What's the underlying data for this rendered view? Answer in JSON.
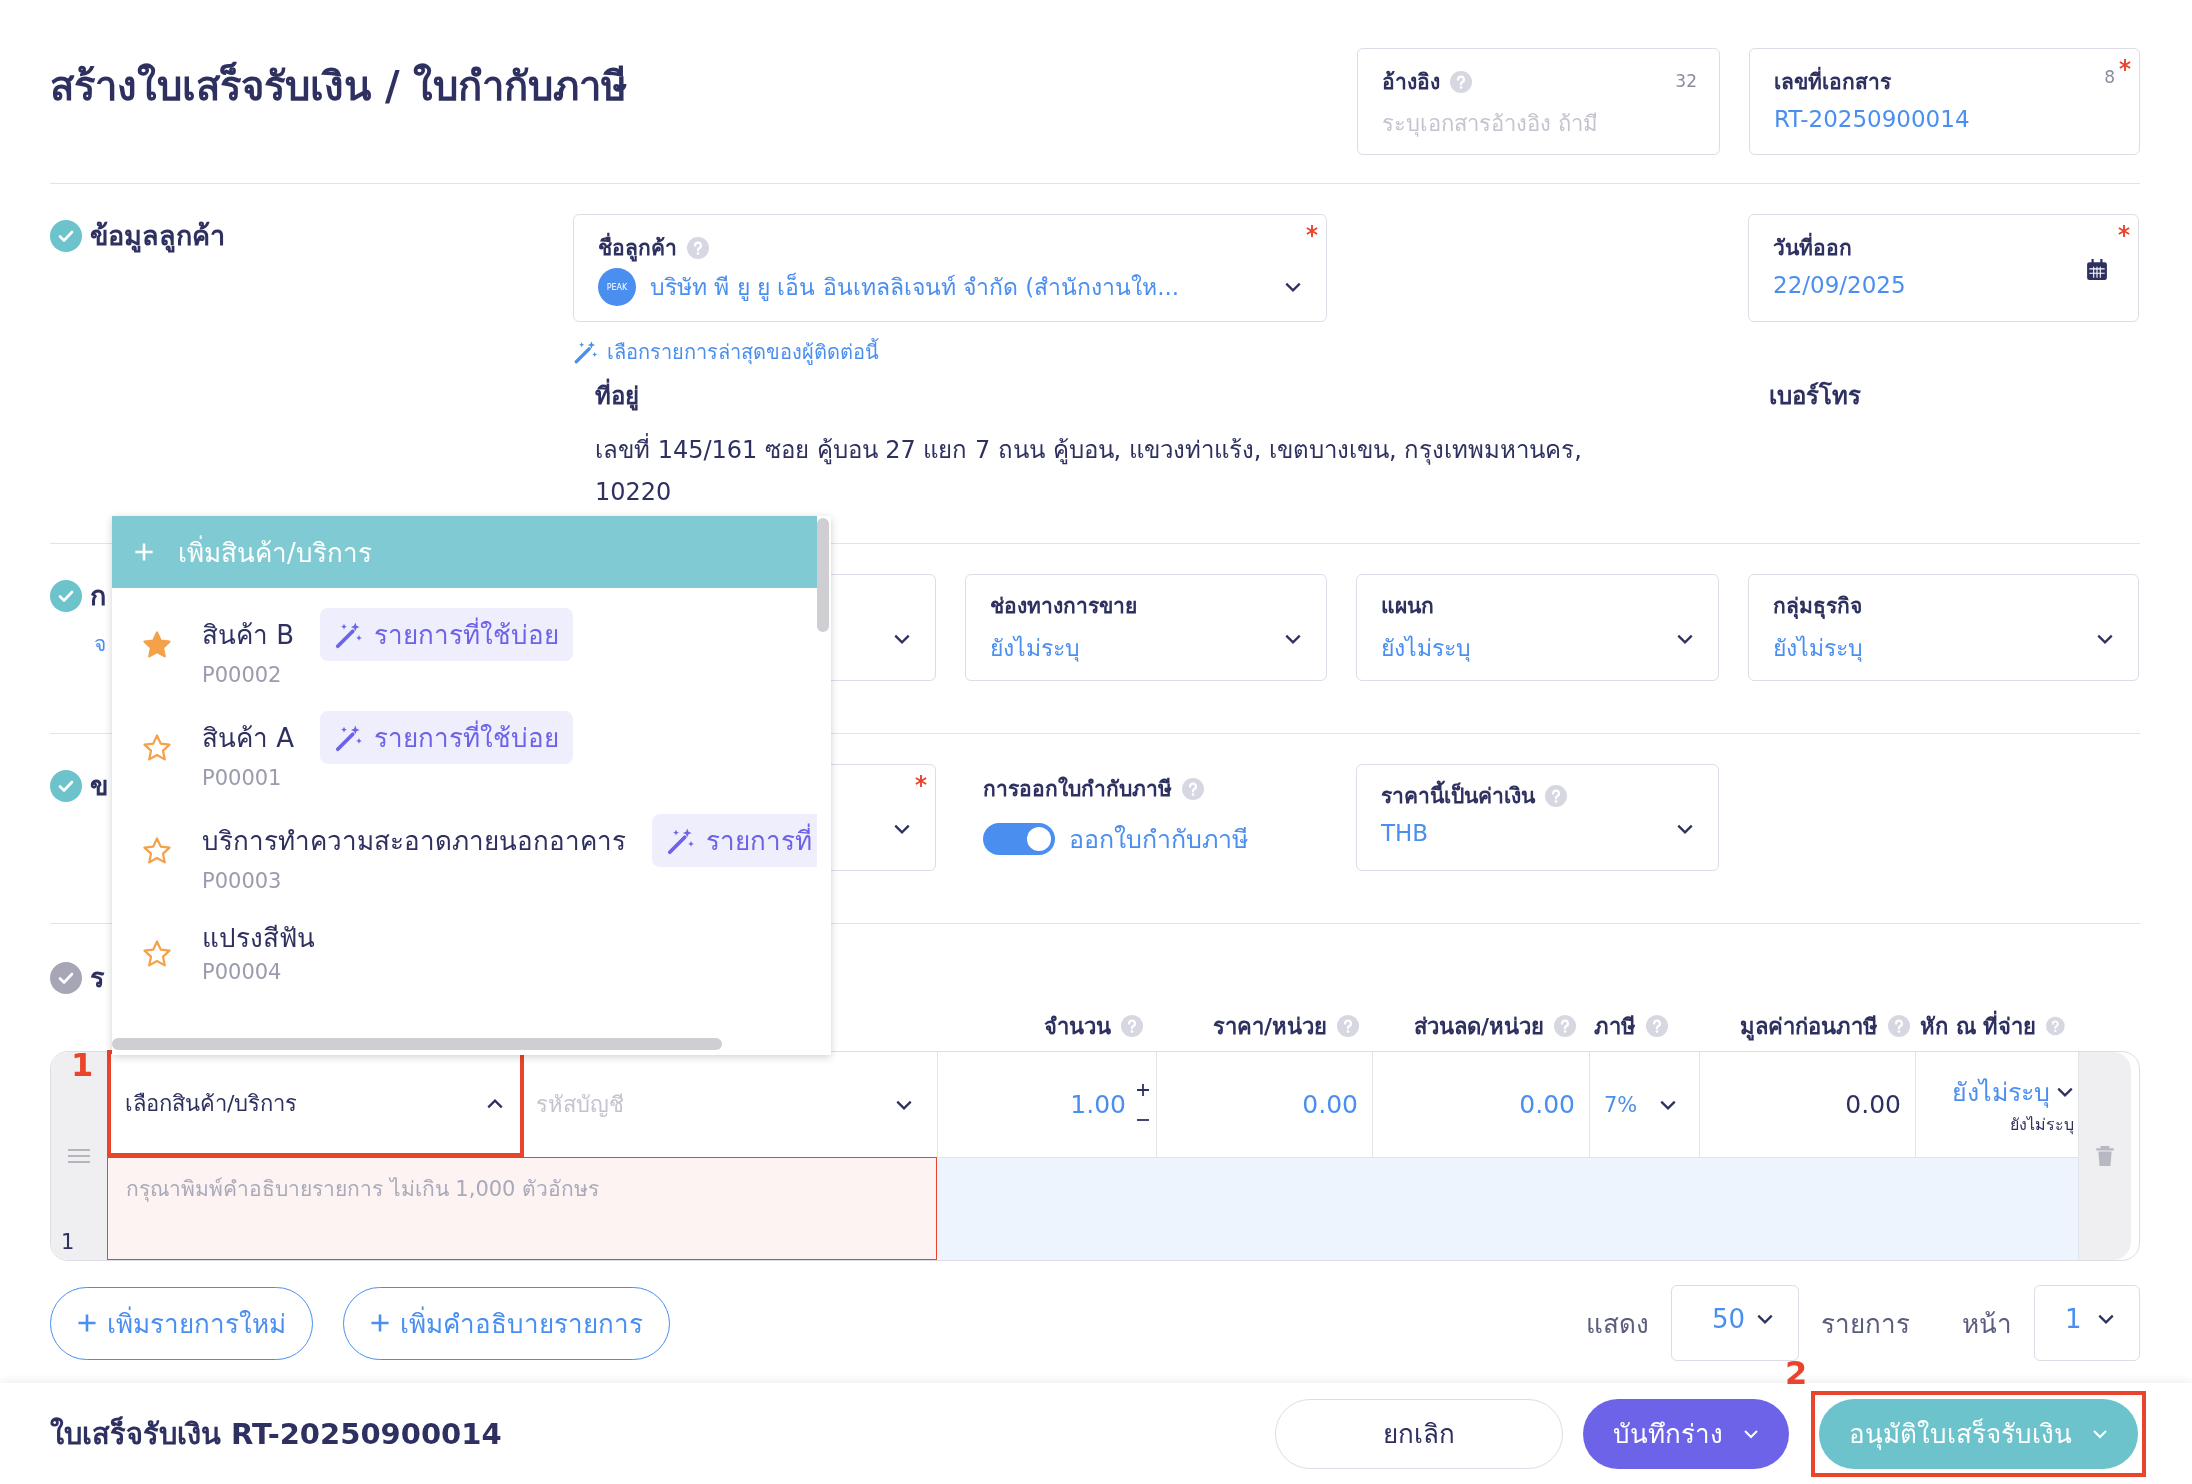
{
  "page_title": "สร้างใบเสร็จรับเงิน / ใบกำกับภาษี",
  "header_fields": [
    {
      "label": "อ้างอิง",
      "help": true,
      "counter": "32",
      "placeholder": "ระบุเอกสารอ้างอิง ถ้ามี",
      "required": false
    },
    {
      "label": "เลขที่เอกสาร",
      "help": false,
      "counter": "8",
      "value": "RT-20250900014",
      "required": true
    }
  ],
  "sections": [
    {
      "kind": "customer",
      "title": "ข้อมูลลูกค้า",
      "done": true,
      "customer": {
        "label": "ชื่อลูกค้า",
        "help": true,
        "required": true,
        "avatar": "PEAK",
        "value": "บริษัท พี ยู ยู เอ็น อินเทลลิเจนท์ จำกัด (สำนักงานให..."
      },
      "issue_date": {
        "label": "วันที่ออก",
        "required": true,
        "value": "22/09/2025"
      },
      "recent_link": "เลือกรายการล่าสุดของผู้ติดต่อนี้",
      "address": {
        "label": "ที่อยู่",
        "value": "เลขที่ 145/161 ซอย คู้บอน 27 แยก 7 ถนน คู้บอน, แขวงท่าแร้ง, เขตบางเขน, กรุงเทพมหานคร, 10220"
      },
      "phone": {
        "label": "เบอร์โทร"
      }
    },
    {
      "kind": "fields",
      "title": "ก",
      "link": "จ",
      "done": true,
      "fields": [
        {
          "kind": "select",
          "required": false
        },
        {
          "kind": "select",
          "label": "ช่องทางการขาย",
          "value": "ยังไม่ระบุ",
          "required": false
        },
        {
          "kind": "select",
          "label": "แผนก",
          "value": "ยังไม่ระบุ",
          "required": false
        },
        {
          "kind": "select",
          "label": "กลุ่มธุรกิจ",
          "value": "ยังไม่ระบุ",
          "required": false
        }
      ]
    },
    {
      "kind": "fields",
      "title": "ข",
      "done": true,
      "fields": [
        {
          "kind": "select",
          "required": true
        },
        {
          "kind": "toggle",
          "label": "การออกใบกำกับภาษี",
          "help": true,
          "on": true,
          "value": "ออกใบกำกับภาษี"
        },
        {
          "kind": "select",
          "label": "ราคานี้เป็นค่าเงิน",
          "help": true,
          "value": "THB",
          "required": false
        }
      ]
    },
    {
      "kind": "items",
      "title": "ร",
      "done": false
    }
  ],
  "items_table": {
    "columns": [
      {
        "label": "จำนวน",
        "help": true
      },
      {
        "label": "ราคา/หน่วย",
        "help": true
      },
      {
        "label": "ส่วนลด/หน่วย",
        "help": true
      },
      {
        "label": "ภาษี",
        "help": true
      },
      {
        "label": "มูลค่าก่อนภาษี",
        "help": true
      },
      {
        "label": "หัก ณ ที่จ่าย",
        "help": true
      }
    ],
    "rows": [
      {
        "number": "1",
        "product": {
          "label": "เลือกสินค้า/บริการ",
          "expanded": true,
          "callout": "1"
        },
        "account_placeholder": "รหัสบัญชี",
        "quantity": "1.00",
        "price": "0.00",
        "discount": "0.00",
        "tax": "7%",
        "pre_tax": "0.00",
        "withholding": "ยังไม่ระบุ",
        "withholding_note": "ยังไม่ระบุ",
        "description_placeholder": "กรุณาพิมพ์คำอธิบายรายการ ไม่เกิน 1,000 ตัวอักษร"
      }
    ]
  },
  "product_menu": {
    "add_label": "เพิ่มสินค้า/บริการ",
    "items": [
      {
        "name": "สินค้า B",
        "code": "P00002",
        "favorite": true,
        "tag": "รายการที่ใช้บ่อย"
      },
      {
        "name": "สินค้า A",
        "code": "P00001",
        "favorite": false,
        "tag": "รายการที่ใช้บ่อย"
      },
      {
        "name": "บริการทำความสะอาดภายนอกอาคาร",
        "code": "P00003",
        "favorite": false,
        "tag": "รายการที่"
      },
      {
        "name": "แปรงสีฟัน",
        "code": "P00004",
        "favorite": false
      }
    ]
  },
  "add_buttons": [
    "เพิ่มรายการใหม่",
    "เพิ่มคำอธิบายรายการ"
  ],
  "pagination": {
    "show_label": "แสดง",
    "page_size": "50",
    "unit": "รายการ",
    "page_label": "หน้า",
    "page": "1"
  },
  "footer": {
    "title": "ใบเสร็จรับเงิน RT-20250900014",
    "buttons": [
      {
        "kind": "cancel",
        "label": "ยกเลิก"
      },
      {
        "kind": "draft",
        "label": "บันทึกร่าง"
      },
      {
        "kind": "approve",
        "label": "อนุมัติใบเสร็จรับเงิน",
        "callout": "2"
      }
    ]
  }
}
